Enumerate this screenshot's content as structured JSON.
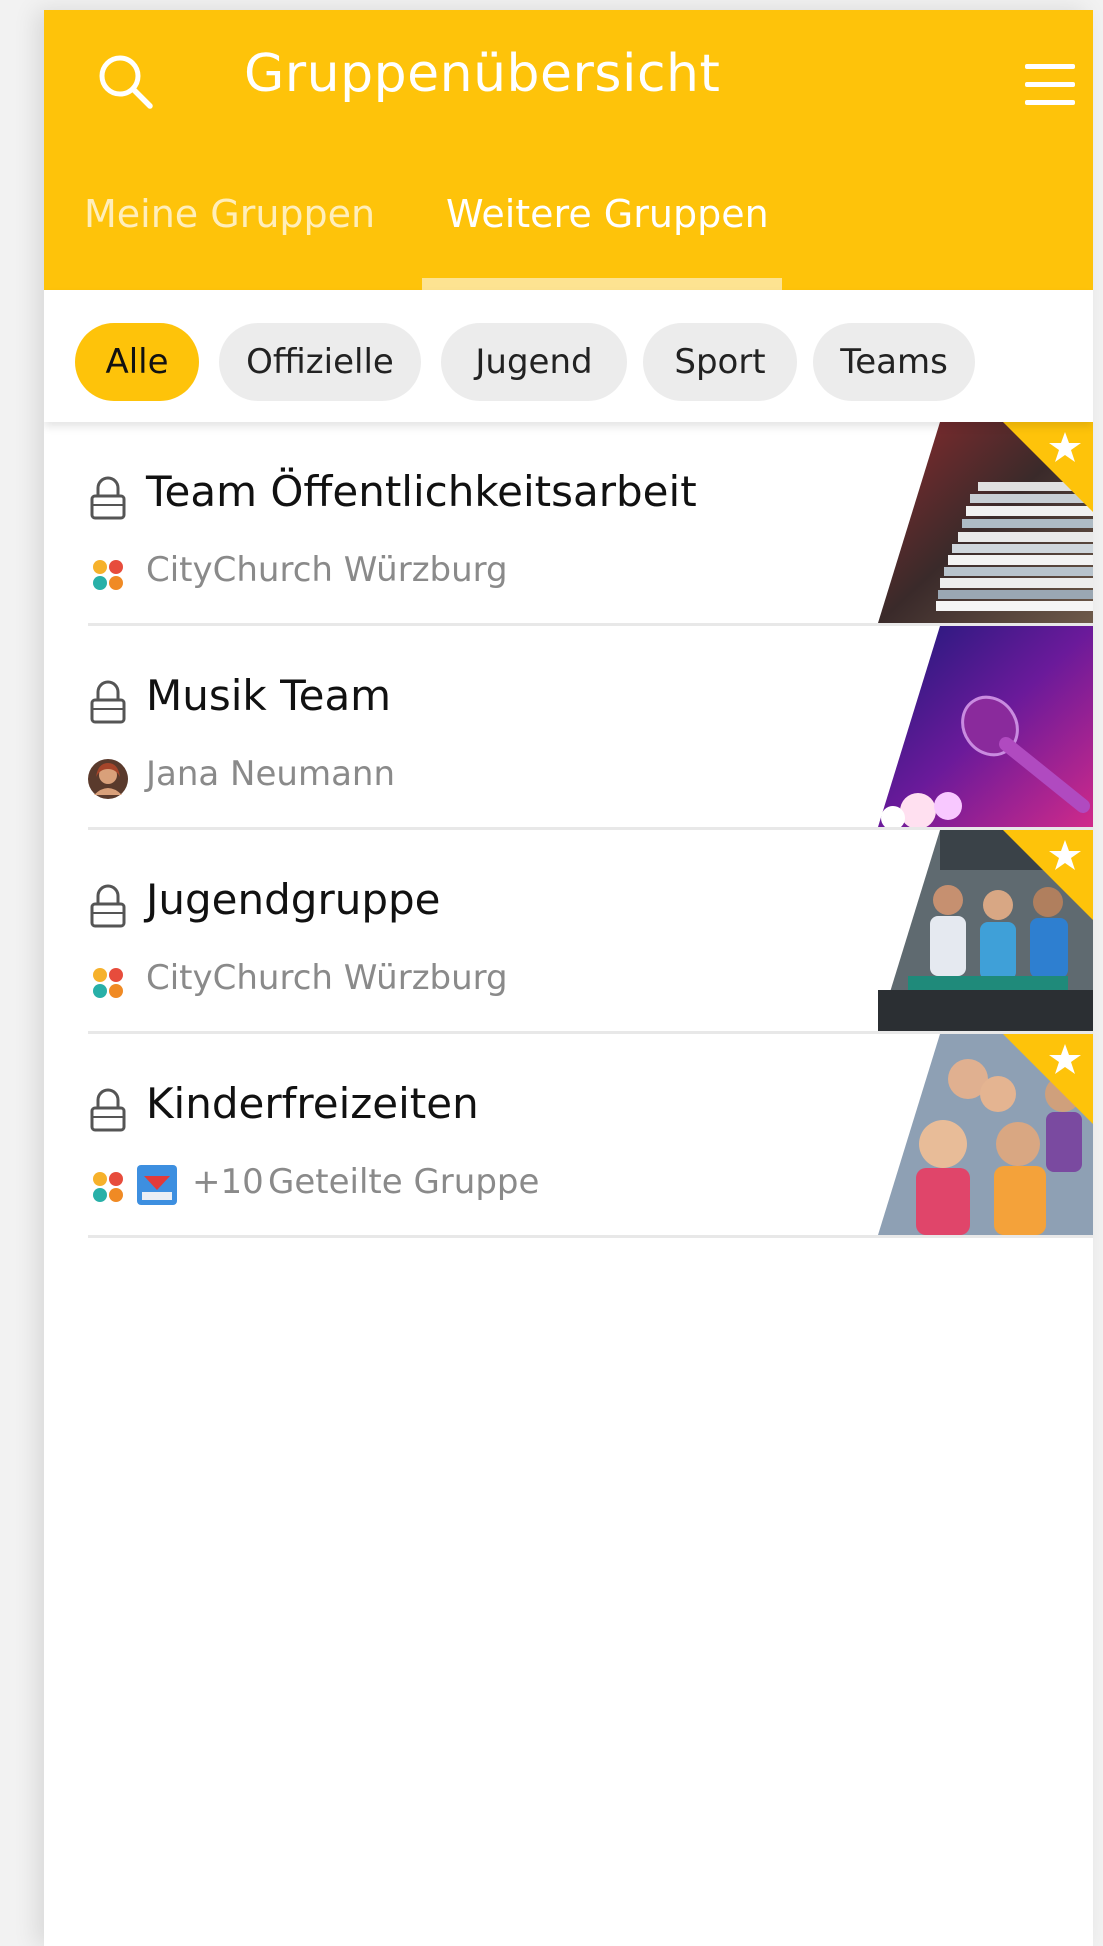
{
  "header": {
    "title": "Gruppenübersicht",
    "search_icon": "search-icon",
    "menu_icon": "hamburger-menu-icon",
    "background": "#fec30a"
  },
  "tabs": [
    {
      "label": "Meine Gruppen",
      "active": false
    },
    {
      "label": "Weitere Gruppen",
      "active": true
    }
  ],
  "filters": [
    {
      "label": "Alle",
      "selected": true
    },
    {
      "label": "Offizielle",
      "selected": false
    },
    {
      "label": "Jugend",
      "selected": false
    },
    {
      "label": "Sport",
      "selected": false
    },
    {
      "label": "Teams",
      "selected": false
    }
  ],
  "groups": [
    {
      "title": "Team Öffentlichkeitsarbeit",
      "subtitle": "CityChurch Würzburg",
      "owner_icon": "citychurch-logo-icon",
      "favorite": true,
      "image": "newspapers-image"
    },
    {
      "title": "Musik Team",
      "subtitle": "Jana Neumann",
      "owner_icon": "user-avatar",
      "favorite": false,
      "image": "microphone-image"
    },
    {
      "title": "Jugendgruppe",
      "subtitle": "CityChurch Würzburg",
      "owner_icon": "citychurch-logo-icon",
      "favorite": true,
      "image": "youth-group-image"
    },
    {
      "title": "Kinderfreizeiten",
      "extra_count": "+10",
      "subtitle": "Geteilte Gruppe",
      "owner_icon": "citychurch-logo-icon",
      "favorite": true,
      "image": "children-image"
    }
  ]
}
